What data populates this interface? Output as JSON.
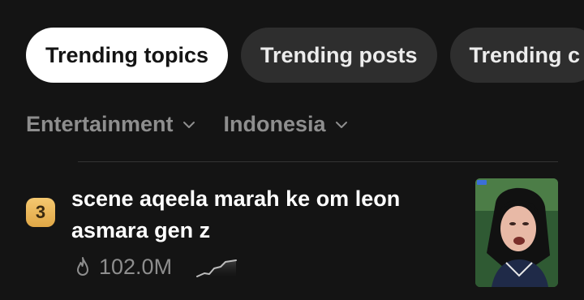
{
  "tabs": [
    {
      "label": "Trending topics",
      "active": true
    },
    {
      "label": "Trending posts",
      "active": false
    },
    {
      "label": "Trending c",
      "active": false
    }
  ],
  "filters": {
    "category": "Entertainment",
    "region": "Indonesia",
    "chevron_icon": "chevron-down-icon"
  },
  "item": {
    "rank": "3",
    "title": "scene aqeela marah ke om leon asmara gen z",
    "views": "102.0M",
    "views_icon": "flame-icon",
    "trend_icon": "trend-sparkline-icon"
  },
  "colors": {
    "background": "#141414",
    "tab_active_bg": "#ffffff",
    "tab_inactive_bg": "#2e2e2e",
    "muted_text": "#8e8e8e",
    "rank_badge": "#e9b55a"
  }
}
